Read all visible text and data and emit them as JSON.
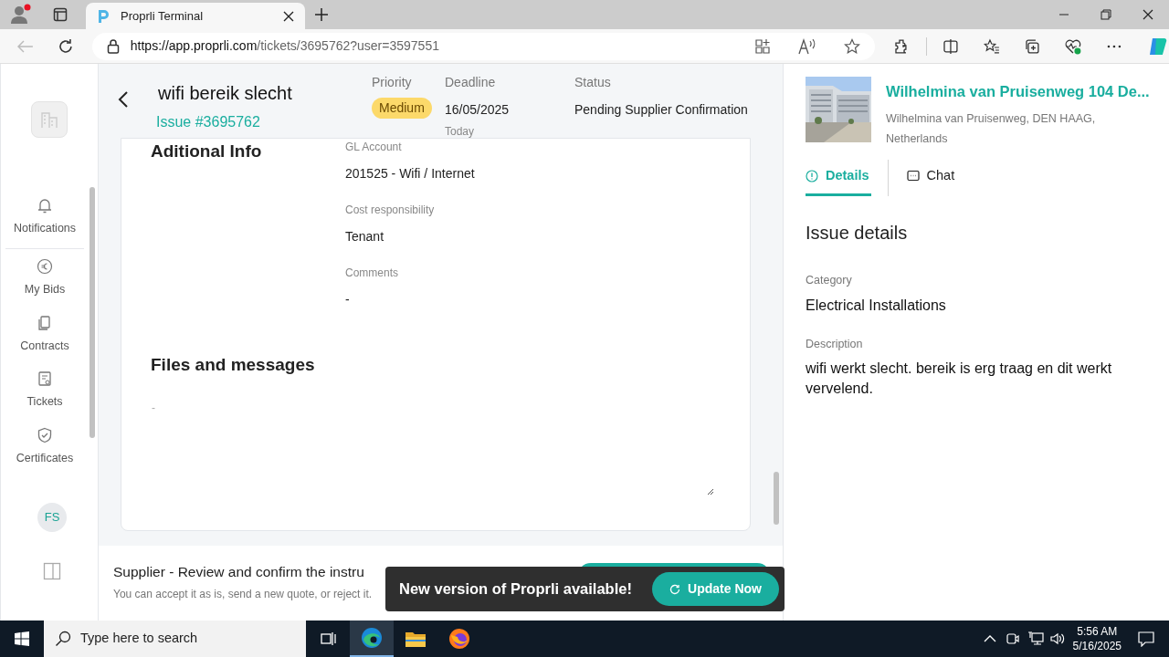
{
  "browser": {
    "tabs": [
      {
        "title": "Proprli Terminal",
        "selected": true
      }
    ],
    "url_host": "https://app.proprli.com",
    "url_path": "/tickets/3695762?user=3597551"
  },
  "sidebar": {
    "items": [
      {
        "label": "Notifications"
      },
      {
        "label": "My Bids"
      },
      {
        "label": "Contracts"
      },
      {
        "label": "Tickets"
      },
      {
        "label": "Certificates"
      }
    ],
    "avatar": "FS"
  },
  "header": {
    "title": "wifi bereik slecht",
    "issue": "Issue #3695762",
    "priority_label": "Priority",
    "priority": "Medium",
    "deadline_label": "Deadline",
    "deadline": "16/05/2025",
    "deadline_note": "Today",
    "status_label": "Status",
    "status": "Pending Supplier Confirmation"
  },
  "info": {
    "title": "Aditional Info",
    "fields": [
      {
        "label": "GL Account",
        "value": "201525 - Wifi / Internet"
      },
      {
        "label": "Cost responsibility",
        "value": "Tenant"
      },
      {
        "label": "Comments",
        "value": "-"
      }
    ],
    "files_title": "Files and messages",
    "files_value": "-"
  },
  "footer": {
    "title": "Supplier - Review and confirm the instru",
    "subtitle": "You can accept it as is, send a new quote, or reject it."
  },
  "toast": {
    "message": "New version of Proprli available!",
    "button": "Update Now"
  },
  "property": {
    "name": "Wilhelmina van Pruisenweg 104 De...",
    "address": "Wilhelmina van Pruisenweg, DEN HAAG, Netherlands"
  },
  "panel_tabs": [
    {
      "label": "Details",
      "selected": true
    },
    {
      "label": "Chat",
      "selected": false
    }
  ],
  "details": {
    "title": "Issue details",
    "fields": [
      {
        "label": "Category",
        "value": "Electrical Installations"
      },
      {
        "label": "Description",
        "value": "wifi werkt slecht. bereik is erg traag en dit werkt vervelend."
      }
    ]
  },
  "taskbar": {
    "search_placeholder": "Type here to search",
    "time": "5:56 AM",
    "date": "5/16/2025"
  }
}
